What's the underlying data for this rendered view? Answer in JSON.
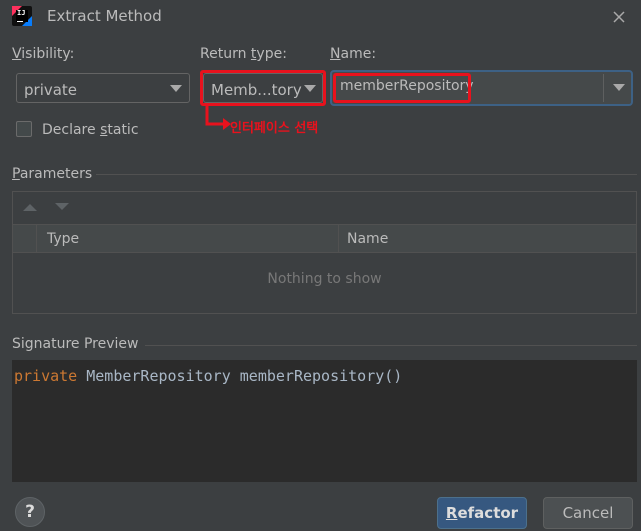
{
  "window": {
    "title": "Extract Method"
  },
  "visibility": {
    "label_mnemonic": "V",
    "label_rest": "isibility:",
    "value": "private"
  },
  "return_type": {
    "label_pre": "Return ",
    "label_mnemonic": "t",
    "label_post": "ype:",
    "value": "Memb...tory"
  },
  "name": {
    "label_mnemonic": "N",
    "label_rest": "ame:",
    "value": "memberRepository"
  },
  "declare_static": {
    "label_pre": "Declare ",
    "label_mnemonic": "s",
    "label_post": "tatic",
    "checked": false
  },
  "annotation": {
    "text": "인터페이스 선택",
    "color": "#e8121d"
  },
  "parameters": {
    "title_mnemonic": "P",
    "title_rest": "arameters",
    "columns": [
      "Type",
      "Name"
    ],
    "empty_text": "Nothing to show"
  },
  "signature_preview": {
    "title": "Signature Preview",
    "keyword": "private",
    "rest": " MemberRepository memberRepository()"
  },
  "buttons": {
    "refactor_mnemonic": "R",
    "refactor_rest": "efactor",
    "cancel": "Cancel",
    "help": "?"
  },
  "colors": {
    "background": "#3c3f41",
    "accent": "#365880",
    "keyword": "#cc7832",
    "highlight": "#e8121d"
  }
}
